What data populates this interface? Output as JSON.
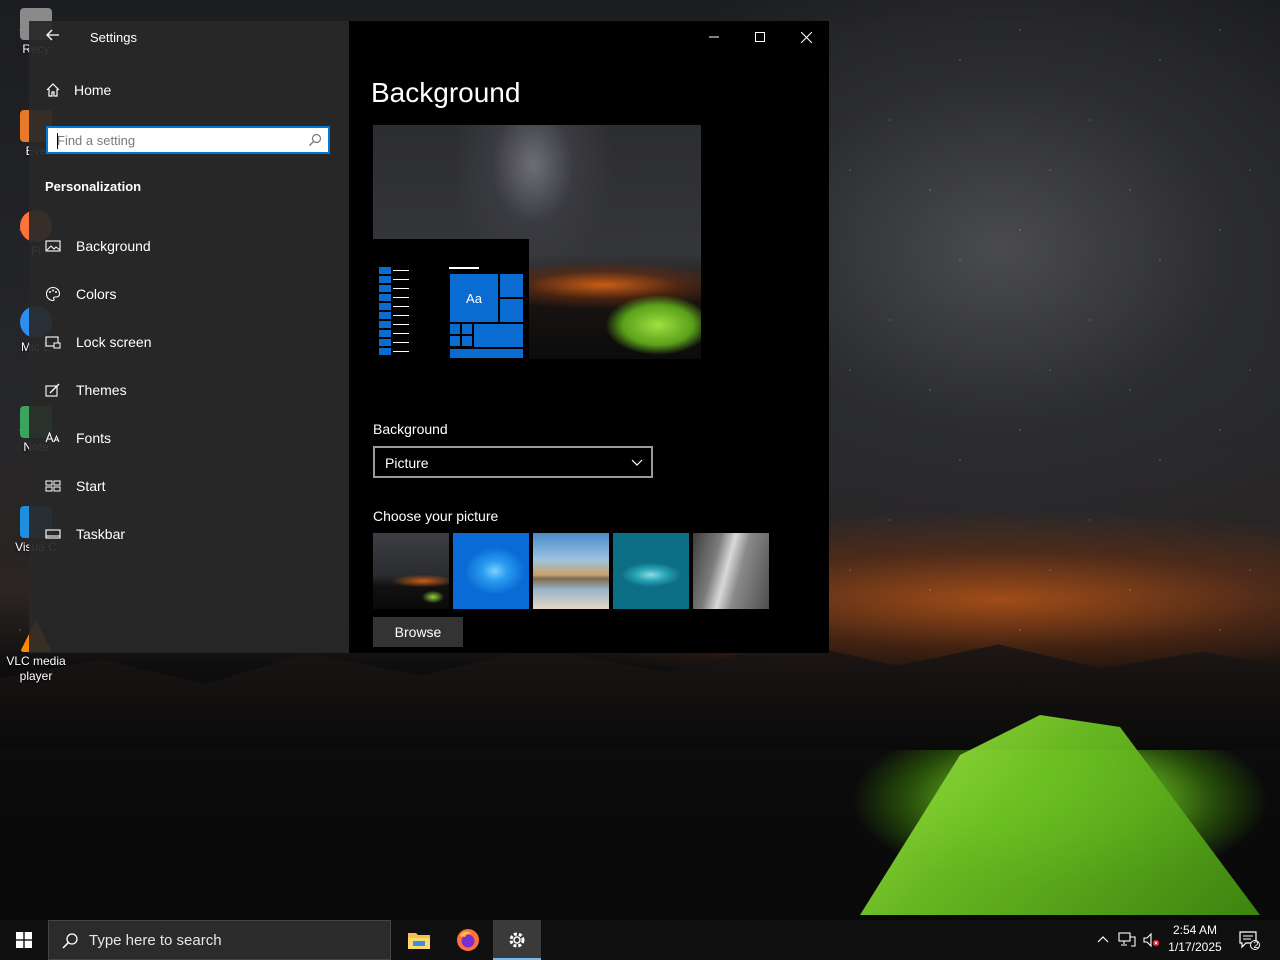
{
  "desktop": {
    "icons": [
      {
        "label": "Recy",
        "color": "#8a8a8a"
      },
      {
        "label": "Eve",
        "color": "#e8782a"
      },
      {
        "label": "Fi",
        "color": "#ff7139"
      },
      {
        "label": "Mic E",
        "color": "#2b8ef0"
      },
      {
        "label": "Note",
        "color": "#3aa55e"
      },
      {
        "label": "Visua C",
        "color": "#1e8fdf"
      },
      {
        "label": "VLC media player",
        "color": "#ff8800"
      }
    ]
  },
  "settings": {
    "window_title": "Settings",
    "home_label": "Home",
    "search_placeholder": "Find a setting",
    "section_title": "Personalization",
    "nav": [
      {
        "label": "Background",
        "icon": "picture-icon"
      },
      {
        "label": "Colors",
        "icon": "palette-icon"
      },
      {
        "label": "Lock screen",
        "icon": "lock-screen-icon"
      },
      {
        "label": "Themes",
        "icon": "themes-icon"
      },
      {
        "label": "Fonts",
        "icon": "fonts-icon"
      },
      {
        "label": "Start",
        "icon": "start-icon"
      },
      {
        "label": "Taskbar",
        "icon": "taskbar-icon"
      }
    ],
    "page_title": "Background",
    "preview_tile_text": "Aa",
    "background_label": "Background",
    "background_value": "Picture",
    "choose_label": "Choose your picture",
    "browse_label": "Browse",
    "accent_color": "#0078d7"
  },
  "taskbar": {
    "search_placeholder": "Type here to search",
    "time": "2:54 AM",
    "date": "1/17/2025",
    "notification_count": "2",
    "apps": [
      "file-explorer-icon",
      "firefox-icon",
      "settings-gear-icon"
    ]
  }
}
